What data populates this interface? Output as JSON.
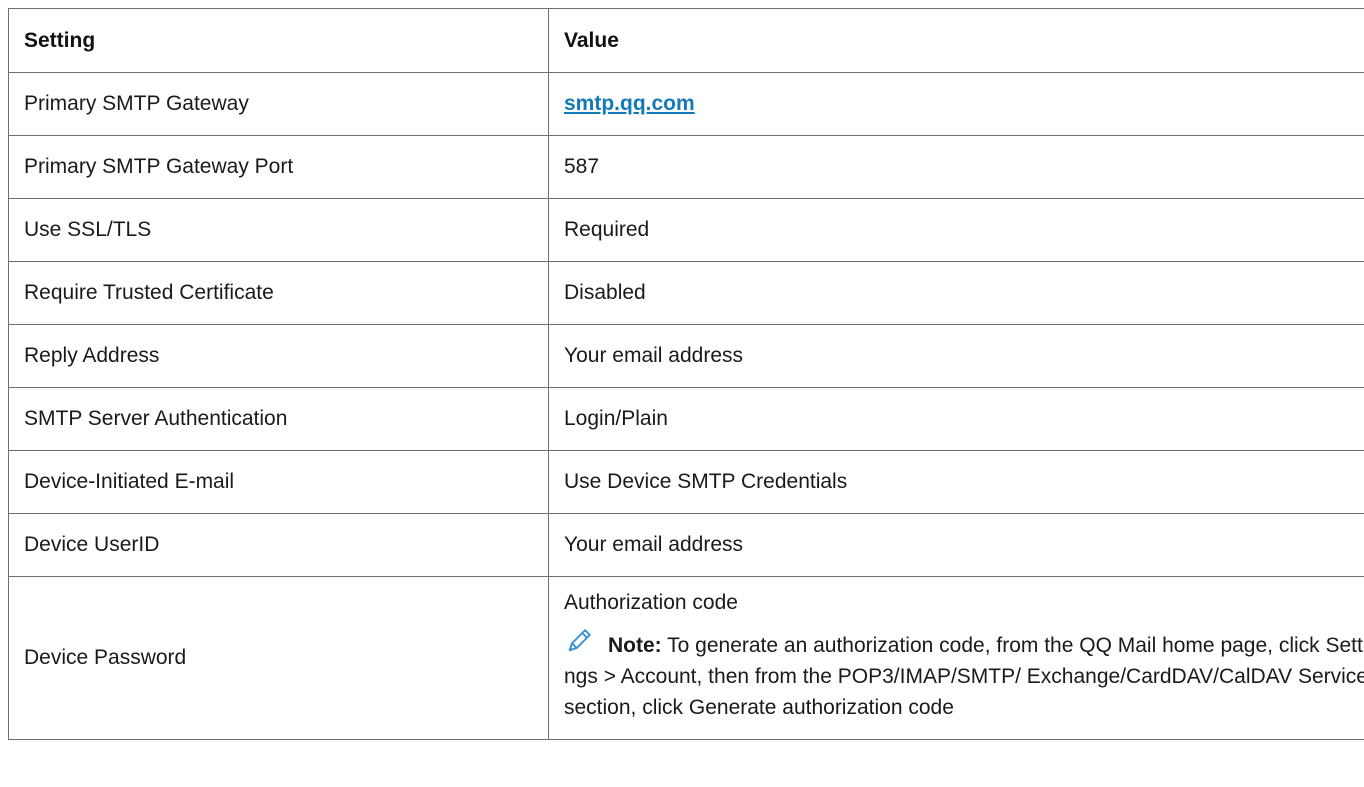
{
  "header": {
    "setting": "Setting",
    "value": "Value"
  },
  "rows": [
    {
      "setting": "Primary SMTP Gateway",
      "value": "smtp.qq.com"
    },
    {
      "setting": "Primary SMTP Gateway Port",
      "value": "587"
    },
    {
      "setting": "Use SSL/TLS",
      "value": "Required"
    },
    {
      "setting": "Require Trusted Certificate",
      "value": "Disabled"
    },
    {
      "setting": "Reply Address",
      "value": "Your email address"
    },
    {
      "setting": "SMTP Server Authentication",
      "value": "Login/Plain"
    },
    {
      "setting": "Device-Initiated E-mail",
      "value": "Use Device SMTP Credentials"
    },
    {
      "setting": "Device UserID",
      "value": "Your email address"
    },
    {
      "setting": "Device Password",
      "value": "Authorization code",
      "note_label": "Note:",
      "note_text": "To generate an authorization code, from the QQ Mail home page, click Settings > Account, then from the POP3/IMAP/SMTP/ Exchange/CardDAV/CalDAV Service section, click Generate authorization code"
    }
  ],
  "icons": {
    "note": "pencil-icon"
  },
  "colors": {
    "link": "#1479b8",
    "border": "#6f6f6f",
    "icon": "#3a8fd6"
  }
}
